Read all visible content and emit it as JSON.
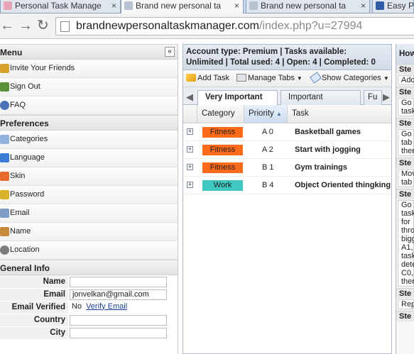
{
  "browser": {
    "tabs": [
      {
        "title": "Personal Task Manage"
      },
      {
        "title": "Brand new personal ta"
      },
      {
        "title": "Brand new personal ta"
      },
      {
        "title": "Easy P"
      }
    ],
    "close_glyph": "×",
    "url_host": "brandnewpersonaltaskmanager.com",
    "url_path": "/index.php?u=27994"
  },
  "left": {
    "menu_header": "Menu",
    "menu_items": [
      {
        "label": "Invite Your Friends",
        "icon": "users-icon"
      },
      {
        "label": "Sign Out",
        "icon": "sign-out-icon"
      },
      {
        "label": "FAQ",
        "icon": "help-icon"
      }
    ],
    "prefs_header": "Preferences",
    "prefs_items": [
      {
        "label": "Categories",
        "icon": "tag-icon"
      },
      {
        "label": "Language",
        "icon": "language-icon"
      },
      {
        "label": "Skin",
        "icon": "rainbow-icon"
      },
      {
        "label": "Password",
        "icon": "key-icon"
      },
      {
        "label": "Email",
        "icon": "envelope-icon"
      },
      {
        "label": "Name",
        "icon": "user-icon"
      },
      {
        "label": "Location",
        "icon": "clock-icon"
      }
    ],
    "info_header": "General Info",
    "info_rows": [
      {
        "label": "Name",
        "value": ""
      },
      {
        "label": "Email",
        "value": "jonvelkan@gmail.com"
      },
      {
        "label": "Email Verified",
        "value": "No",
        "link": "Verify Email"
      },
      {
        "label": "Country",
        "value": ""
      },
      {
        "label": "City",
        "value": ""
      }
    ]
  },
  "main": {
    "account_line1": "Account type: Premium | Tasks available:",
    "account_line2": "Unlimited | Total used: 4 | Open: 4 | Completed: 0",
    "toolbar": {
      "add_task": "Add Task",
      "manage_tabs": "Manage Tabs",
      "show_categories": "Show Categories"
    },
    "tabs": [
      "Very Important",
      "Important",
      "Fu"
    ],
    "columns": {
      "category": "Category",
      "priority": "Priority",
      "task": "Task"
    },
    "rows": [
      {
        "category": "Fitness",
        "cat_color": "#ff6a1a",
        "priority": "A 0",
        "task": "Basketball games"
      },
      {
        "category": "Fitness",
        "cat_color": "#ff6a1a",
        "priority": "A 2",
        "task": "Start with jogging"
      },
      {
        "category": "Fitness",
        "cat_color": "#ff6a1a",
        "priority": "B 1",
        "task": "Gym trainings"
      },
      {
        "category": "Work",
        "cat_color": "#3ec8c0",
        "priority": "B 4",
        "task": "Object Oriented thingking"
      }
    ]
  },
  "right": {
    "header": "How",
    "blocks": [
      {
        "step": "Ste",
        "text": [
          "Add"
        ]
      },
      {
        "step": "Ste",
        "text": [
          "Go",
          "task"
        ]
      },
      {
        "step": "Ste",
        "text": [
          "Go",
          "tab",
          "then"
        ]
      },
      {
        "step": "Ste",
        "text": [
          "Mov",
          "tab"
        ]
      },
      {
        "step": "Ste",
        "text": [
          "Go t",
          "task",
          "for",
          "thro",
          "bigg",
          "A1,",
          "task",
          "dete",
          "C0,",
          "then"
        ]
      },
      {
        "step": "Ste",
        "text": [
          "Rep"
        ]
      },
      {
        "step": "Ste",
        "text": []
      }
    ]
  }
}
